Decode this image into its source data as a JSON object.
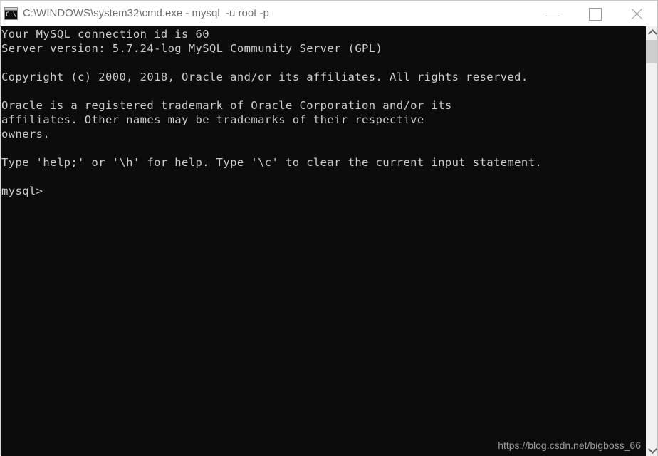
{
  "window": {
    "title": "C:\\WINDOWS\\system32\\cmd.exe - mysql  -u root -p",
    "icon": "cmd-console-icon",
    "icon_prompt_text": "C:\\",
    "background_color": "#0c0c0c",
    "titlebar_color": "#ffffff",
    "title_text_color": "#6e6e6e"
  },
  "titlebar_buttons": {
    "minimize": {
      "name": "minimize-button",
      "glyph": "minimize-icon",
      "label": "Minimize"
    },
    "maximize": {
      "name": "maximize-button",
      "glyph": "maximize-icon",
      "label": "Maximize"
    },
    "close": {
      "name": "close-button",
      "glyph": "close-icon",
      "label": "Close"
    }
  },
  "console": {
    "text_color": "#cccccc",
    "prompt": "mysql>",
    "output": "Your MySQL connection id is 60\nServer version: 5.7.24-log MySQL Community Server (GPL)\n\nCopyright (c) 2000, 2018, Oracle and/or its affiliates. All rights reserved.\n\nOracle is a registered trademark of Oracle Corporation and/or its\naffiliates. Other names may be trademarks of their respective\nowners.\n\nType 'help;' or '\\h' for help. Type '\\c' to clear the current input statement.\n\nmysql>",
    "lines": [
      "Your MySQL connection id is 60",
      "Server version: 5.7.24-log MySQL Community Server (GPL)",
      "",
      "Copyright (c) 2000, 2018, Oracle and/or its affiliates. All rights reserved.",
      "",
      "Oracle is a registered trademark of Oracle Corporation and/or its",
      "affiliates. Other names may be trademarks of their respective",
      "owners.",
      "",
      "Type 'help;' or '\\h' for help. Type '\\c' to clear the current input statement.",
      "",
      "mysql>"
    ]
  },
  "watermark": {
    "text": "https://blog.csdn.net/bigboss_66",
    "color": "#9b9b9b"
  },
  "scrollbar": {
    "up_arrow": "chevron-up-icon",
    "down_arrow": "chevron-down-icon",
    "thumb_color": "#cdcdcd",
    "track_color": "#f0f0f0"
  }
}
